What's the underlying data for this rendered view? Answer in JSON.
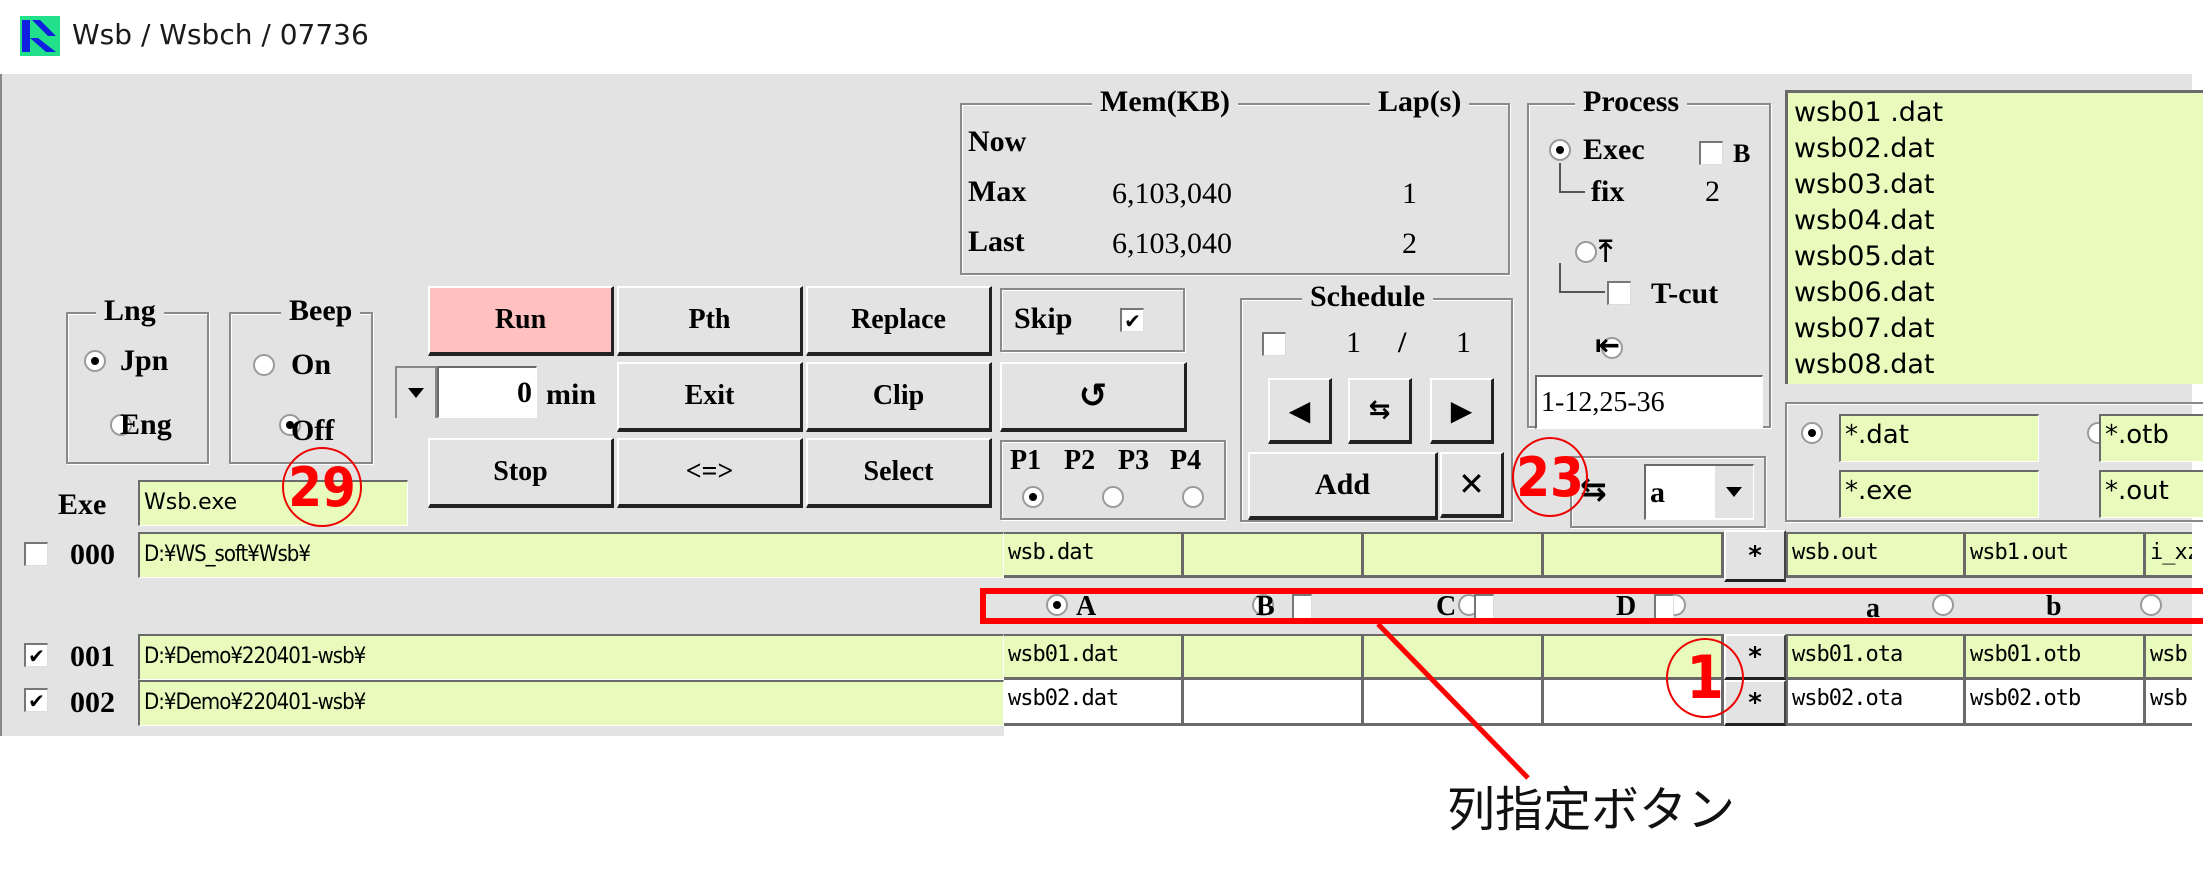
{
  "window": {
    "title": "Wsb / Wsbch / 07736",
    "icon": "app-logo-icon"
  },
  "memory": {
    "header_mem": "Mem(KB)",
    "header_lap": "Lap(s)",
    "rows": [
      {
        "label": "Now",
        "mem": "",
        "lap": ""
      },
      {
        "label": "Max",
        "mem": "6,103,040",
        "lap": "1"
      },
      {
        "label": "Last",
        "mem": "6,103,040",
        "lap": "2"
      }
    ]
  },
  "process": {
    "legend": "Process",
    "exec_label": "Exec",
    "exec_selected": true,
    "b_label": "B",
    "b_checked": false,
    "fix_label": "fix",
    "fix_value": "2",
    "top_icon": "arrow-up-bar-icon",
    "tcut_label": "T-cut",
    "tcut_checked": false,
    "left_icon": "arrow-left-bar-icon",
    "range_value": "1-12,25-36"
  },
  "file_list": [
    "wsb01 .dat",
    "wsb02.dat",
    "wsb03.dat",
    "wsb04.dat",
    "wsb05.dat",
    "wsb06.dat",
    "wsb07.dat",
    "wsb08.dat"
  ],
  "filters": [
    {
      "value": "*.dat",
      "selected": true
    },
    {
      "value": "*.otb",
      "selected": false
    },
    {
      "value": "*.exe",
      "selected": false
    },
    {
      "value": "*.out",
      "selected": false
    }
  ],
  "lng": {
    "legend": "Lng",
    "options": [
      {
        "label": "Jpn",
        "selected": true
      },
      {
        "label": "Eng",
        "selected": false
      }
    ]
  },
  "beep": {
    "legend": "Beep",
    "options": [
      {
        "label": "On",
        "selected": false
      },
      {
        "label": "Off",
        "selected": true
      }
    ]
  },
  "buttons": {
    "run": "Run",
    "pth": "Pth",
    "replace": "Replace",
    "exit": "Exit",
    "clip": "Clip",
    "refresh_icon": "refresh-icon",
    "stop": "Stop",
    "swap": "<=>",
    "select": "Select",
    "add": "Add",
    "delete_icon": "close-icon"
  },
  "skip": {
    "label": "Skip",
    "checked": true
  },
  "timer": {
    "value": "0",
    "unit": "min"
  },
  "priority": {
    "options": [
      "P1",
      "P2",
      "P3",
      "P4"
    ],
    "selected": "P1"
  },
  "schedule": {
    "legend": "Schedule",
    "checked": false,
    "current": "1",
    "separator": "/",
    "total": "1"
  },
  "swap_select": {
    "value": "a"
  },
  "exe": {
    "label": "Exe",
    "value": "Wsb.exe"
  },
  "rows": [
    {
      "checked": false,
      "index": "000",
      "path": "D:¥WS_soft¥Wsb¥",
      "cols": [
        "wsb.dat",
        "",
        "",
        ""
      ],
      "outs": [
        "wsb.out",
        "wsb1.out",
        "i_xz"
      ],
      "highlight": true
    },
    {
      "checked": true,
      "index": "001",
      "path": "D:¥Demo¥220401-wsb¥",
      "cols": [
        "wsb01.dat",
        "",
        "",
        ""
      ],
      "outs": [
        "wsb01.ota",
        "wsb01.otb",
        "wsb"
      ],
      "highlight": true
    },
    {
      "checked": true,
      "index": "002",
      "path": "D:¥Demo¥220401-wsb¥",
      "cols": [
        "wsb02.dat",
        "",
        "",
        ""
      ],
      "outs": [
        "wsb02.ota",
        "wsb02.otb",
        "wsb"
      ],
      "highlight": false
    }
  ],
  "star_label": "*",
  "column_selectors": [
    {
      "label": "A",
      "selected": true,
      "has_check": false
    },
    {
      "label": "B",
      "selected": false,
      "has_check": true
    },
    {
      "label": "C",
      "selected": false,
      "has_check": true
    },
    {
      "label": "D",
      "selected": false,
      "has_check": true
    },
    {
      "label": "a",
      "selected": false,
      "has_check": false
    },
    {
      "label": "b",
      "selected": false,
      "has_check": false
    }
  ],
  "annotations": {
    "badge_29": "29",
    "badge_23": "23",
    "badge_1": "1",
    "caption": "列指定ボタン",
    "color": "#ff0000"
  }
}
